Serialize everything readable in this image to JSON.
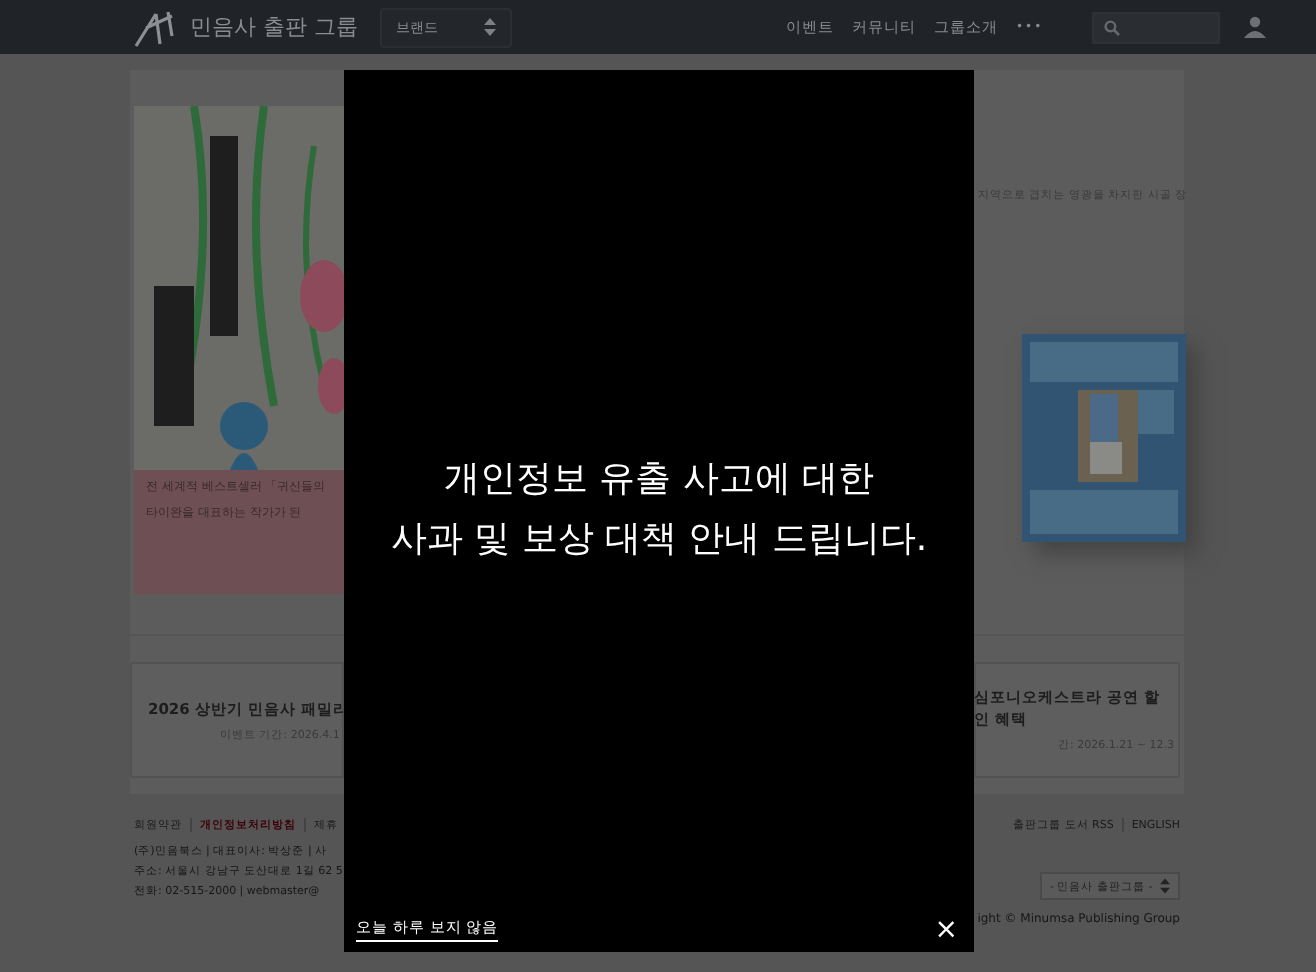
{
  "header": {
    "logo": "민음사 출판 그룹",
    "brand_select": "브랜드",
    "nav": [
      "이벤트",
      "커뮤니티",
      "그룹소개"
    ],
    "more": "•••"
  },
  "hero": {
    "left_caption": [
      "전 세계적 베스트셀러 「귀신들의",
      "타이완을 대표하는 작가가 된"
    ],
    "right_text": "지역으로 겹치는 영광을 차지한 시골 장"
  },
  "cards": [
    {
      "title": "2026 상반기 민음사 패밀리",
      "period": "이벤트 기간: 2026.4.1"
    },
    {
      "title": "심포니오케스트라 공연 할 인 혜택",
      "period": "간: 2026.1.21 ~ 12.3"
    }
  ],
  "footer": {
    "left_links": [
      {
        "label": "회원약관",
        "highlight": false
      },
      {
        "label": "개인정보처리방침",
        "highlight": true
      },
      {
        "label": "제휴",
        "highlight": false
      }
    ],
    "right_links": [
      "출판그룹 도서 RSS",
      "ENGLISH"
    ],
    "info": [
      "(주)민음북스 | 대표이사: 박상준 | 사",
      "주소: 서울시 강남구 도산대로 1길 62 5",
      "전화: 02-515-2000 | webmaster@"
    ],
    "group_select": "- 민음사 출판그룹 -",
    "copyright": "ight © Minumsa Publishing Group"
  },
  "popup": {
    "message": [
      "개인정보 유출 사고에 대한",
      "사과 및 보상 대책 안내 드립니다."
    ],
    "dismiss_link": "오늘 하루 보지 않음",
    "close": "×"
  }
}
